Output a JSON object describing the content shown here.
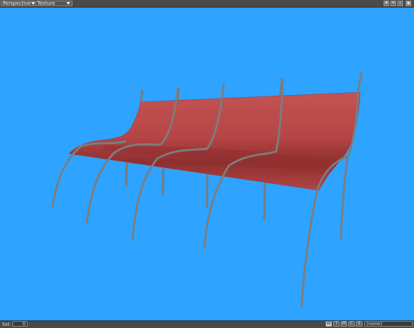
{
  "header": {
    "view_mode": "Perspective",
    "render_mode": "Texture"
  },
  "view_controls": [
    {
      "name": "move-view-icon",
      "glyph": "✥"
    },
    {
      "name": "rotate-view-icon",
      "glyph": "⟲"
    },
    {
      "name": "zoom-view-icon",
      "glyph": "⌕"
    },
    {
      "name": "maximize-view-icon",
      "glyph": "▣"
    }
  ],
  "footer": {
    "status_text": "Sel:",
    "value": "0",
    "toggles": [
      "W",
      "T",
      "M",
      "C",
      "S"
    ],
    "active_toggle": "W",
    "layer_text": "(none)"
  },
  "colors": {
    "viewport_bg": "#2ea3ff",
    "surface_red": "#b84545",
    "curve_gray": "#7d7d7d",
    "ui_bg": "#4a4a4a"
  }
}
